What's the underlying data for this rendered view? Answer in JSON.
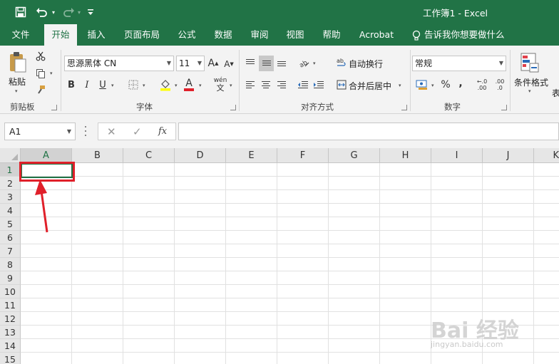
{
  "window": {
    "title": "工作簿1  -  Excel"
  },
  "quick_access": {
    "save_icon": "save-icon",
    "undo_icon": "undo-icon",
    "redo_icon": "redo-icon",
    "customize_icon": "customize-quick-access-icon"
  },
  "tabs": [
    "文件",
    "开始",
    "插入",
    "页面布局",
    "公式",
    "数据",
    "审阅",
    "视图",
    "帮助",
    "Acrobat",
    "告诉我你想要做什么"
  ],
  "active_tab": "开始",
  "ribbon": {
    "clipboard": {
      "paste_label": "粘贴",
      "group_label": "剪贴板"
    },
    "font": {
      "font_name": "思源黑体 CN",
      "font_size": "11",
      "bold": "B",
      "italic": "I",
      "underline": "U",
      "grow": "A",
      "shrink": "A",
      "font_color_letter": "A",
      "phonetic": "wén",
      "group_label": "字体"
    },
    "alignment": {
      "wrap_text": "自动换行",
      "merge_center": "合并后居中",
      "group_label": "对齐方式"
    },
    "number": {
      "format": "常规",
      "percent": "%",
      "comma": ",",
      "increase_decimal": ".00",
      "decrease_decimal": ".0",
      "group_label": "数字"
    },
    "styles": {
      "conditional_format": "条件格式",
      "partial_label": "表"
    }
  },
  "formula_bar": {
    "name_box": "A1",
    "cancel": "✕",
    "enter": "✓",
    "fx": "fx",
    "content": ""
  },
  "sheet": {
    "columns": [
      "A",
      "B",
      "C",
      "D",
      "E",
      "F",
      "G",
      "H",
      "I",
      "J",
      "K"
    ],
    "rows": [
      "1",
      "2",
      "3",
      "4",
      "5",
      "6",
      "7",
      "8",
      "9",
      "10",
      "11",
      "12",
      "13",
      "14",
      "15"
    ],
    "selected_cell": "A1"
  },
  "annotation": {
    "highlight_color": "#e0202a"
  },
  "watermark": {
    "text": "Bai 经验",
    "subtext": "jingyan.baidu.com"
  },
  "colors": {
    "accent": "#217346",
    "ribbon_bg": "#f3f3f3"
  }
}
